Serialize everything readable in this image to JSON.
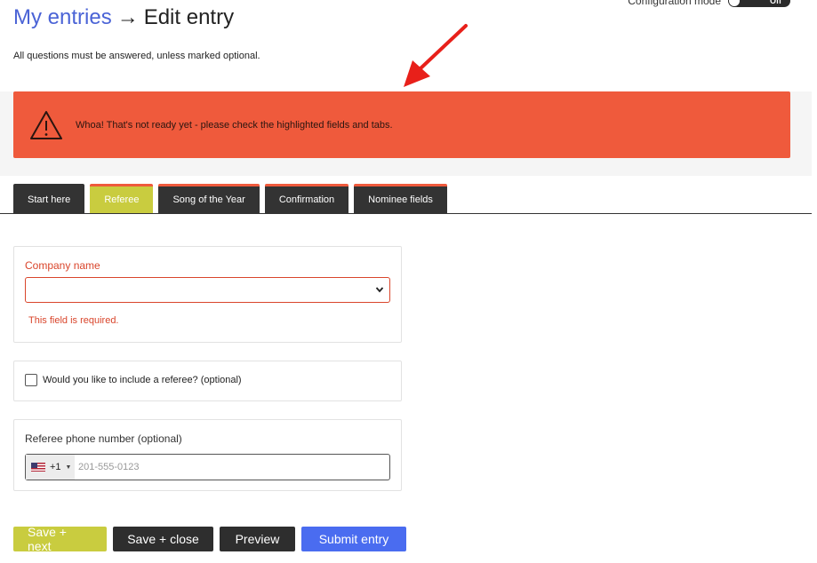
{
  "config_mode": {
    "label": "Configuration mode",
    "state": "Off"
  },
  "header": {
    "link": "My entries",
    "separator": "→",
    "current": "Edit entry"
  },
  "intro_text": "All questions must be answered, unless marked optional.",
  "alert": {
    "message": "Whoa! That's not ready yet - please check the highlighted fields and tabs.",
    "color": "#ef5a3c"
  },
  "tabs": [
    {
      "label": "Start here"
    },
    {
      "label": "Referee"
    },
    {
      "label": "Song of the Year"
    },
    {
      "label": "Confirmation"
    },
    {
      "label": "Nominee fields"
    }
  ],
  "company": {
    "label": "Company name",
    "value": "",
    "error": "This field is required."
  },
  "referee_checkbox": {
    "label": "Would you like to include a referee? (optional)",
    "checked": false
  },
  "phone": {
    "label": "Referee phone number (optional)",
    "dial_code": "+1",
    "placeholder": "201-555-0123"
  },
  "buttons": {
    "save_next": "Save + next",
    "save_close": "Save + close",
    "preview": "Preview",
    "submit": "Submit entry"
  }
}
